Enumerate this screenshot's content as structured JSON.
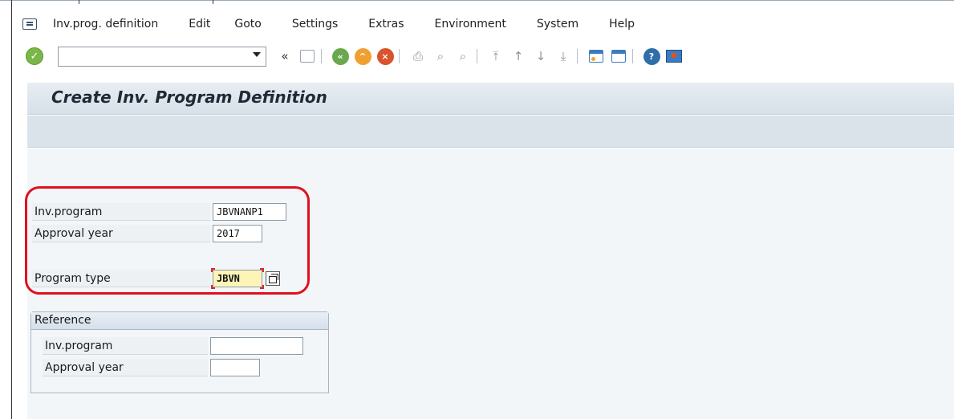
{
  "menubar": {
    "items": [
      "Inv.prog. definition",
      "Edit",
      "Goto",
      "Settings",
      "Extras",
      "Environment",
      "System",
      "Help"
    ]
  },
  "toolbar": {
    "command_value": "",
    "back_label": "«"
  },
  "title": "Create Inv. Program Definition",
  "form": {
    "inv_program_label": "Inv.program",
    "inv_program_value": "JBVNANP1",
    "approval_year_label": "Approval year",
    "approval_year_value": "2017",
    "program_type_label": "Program type",
    "program_type_value": "JBVN"
  },
  "reference": {
    "title": "Reference",
    "inv_program_label": "Inv.program",
    "inv_program_value": "",
    "approval_year_label": "Approval year",
    "approval_year_value": ""
  },
  "colors": {
    "highlight": "#e0101e",
    "required_field": "#fdf4b8",
    "title_band": "#dbe3ea"
  }
}
